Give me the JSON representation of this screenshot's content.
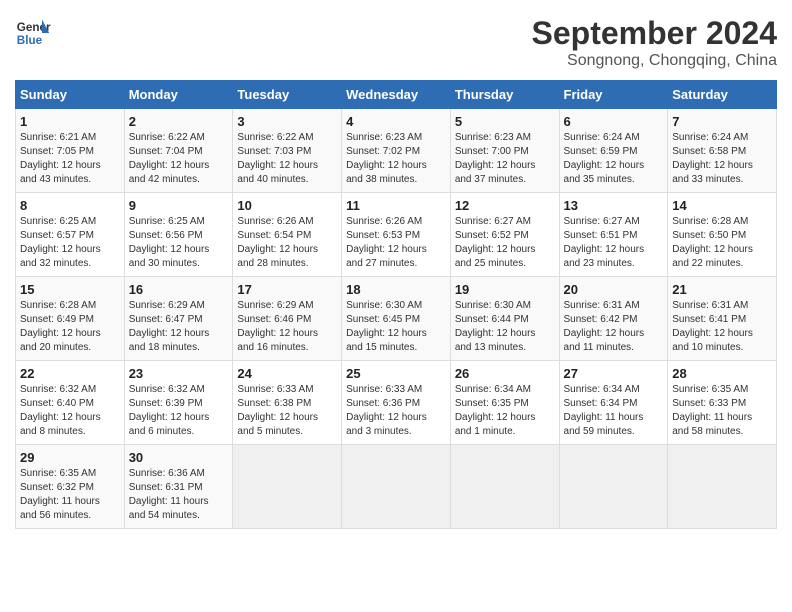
{
  "logo": {
    "line1": "General",
    "line2": "Blue"
  },
  "title": "September 2024",
  "subtitle": "Songnong, Chongqing, China",
  "days_of_week": [
    "Sunday",
    "Monday",
    "Tuesday",
    "Wednesday",
    "Thursday",
    "Friday",
    "Saturday"
  ],
  "weeks": [
    [
      {
        "day": 1,
        "info": "Sunrise: 6:21 AM\nSunset: 7:05 PM\nDaylight: 12 hours\nand 43 minutes."
      },
      {
        "day": 2,
        "info": "Sunrise: 6:22 AM\nSunset: 7:04 PM\nDaylight: 12 hours\nand 42 minutes."
      },
      {
        "day": 3,
        "info": "Sunrise: 6:22 AM\nSunset: 7:03 PM\nDaylight: 12 hours\nand 40 minutes."
      },
      {
        "day": 4,
        "info": "Sunrise: 6:23 AM\nSunset: 7:02 PM\nDaylight: 12 hours\nand 38 minutes."
      },
      {
        "day": 5,
        "info": "Sunrise: 6:23 AM\nSunset: 7:00 PM\nDaylight: 12 hours\nand 37 minutes."
      },
      {
        "day": 6,
        "info": "Sunrise: 6:24 AM\nSunset: 6:59 PM\nDaylight: 12 hours\nand 35 minutes."
      },
      {
        "day": 7,
        "info": "Sunrise: 6:24 AM\nSunset: 6:58 PM\nDaylight: 12 hours\nand 33 minutes."
      }
    ],
    [
      {
        "day": 8,
        "info": "Sunrise: 6:25 AM\nSunset: 6:57 PM\nDaylight: 12 hours\nand 32 minutes."
      },
      {
        "day": 9,
        "info": "Sunrise: 6:25 AM\nSunset: 6:56 PM\nDaylight: 12 hours\nand 30 minutes."
      },
      {
        "day": 10,
        "info": "Sunrise: 6:26 AM\nSunset: 6:54 PM\nDaylight: 12 hours\nand 28 minutes."
      },
      {
        "day": 11,
        "info": "Sunrise: 6:26 AM\nSunset: 6:53 PM\nDaylight: 12 hours\nand 27 minutes."
      },
      {
        "day": 12,
        "info": "Sunrise: 6:27 AM\nSunset: 6:52 PM\nDaylight: 12 hours\nand 25 minutes."
      },
      {
        "day": 13,
        "info": "Sunrise: 6:27 AM\nSunset: 6:51 PM\nDaylight: 12 hours\nand 23 minutes."
      },
      {
        "day": 14,
        "info": "Sunrise: 6:28 AM\nSunset: 6:50 PM\nDaylight: 12 hours\nand 22 minutes."
      }
    ],
    [
      {
        "day": 15,
        "info": "Sunrise: 6:28 AM\nSunset: 6:49 PM\nDaylight: 12 hours\nand 20 minutes."
      },
      {
        "day": 16,
        "info": "Sunrise: 6:29 AM\nSunset: 6:47 PM\nDaylight: 12 hours\nand 18 minutes."
      },
      {
        "day": 17,
        "info": "Sunrise: 6:29 AM\nSunset: 6:46 PM\nDaylight: 12 hours\nand 16 minutes."
      },
      {
        "day": 18,
        "info": "Sunrise: 6:30 AM\nSunset: 6:45 PM\nDaylight: 12 hours\nand 15 minutes."
      },
      {
        "day": 19,
        "info": "Sunrise: 6:30 AM\nSunset: 6:44 PM\nDaylight: 12 hours\nand 13 minutes."
      },
      {
        "day": 20,
        "info": "Sunrise: 6:31 AM\nSunset: 6:42 PM\nDaylight: 12 hours\nand 11 minutes."
      },
      {
        "day": 21,
        "info": "Sunrise: 6:31 AM\nSunset: 6:41 PM\nDaylight: 12 hours\nand 10 minutes."
      }
    ],
    [
      {
        "day": 22,
        "info": "Sunrise: 6:32 AM\nSunset: 6:40 PM\nDaylight: 12 hours\nand 8 minutes."
      },
      {
        "day": 23,
        "info": "Sunrise: 6:32 AM\nSunset: 6:39 PM\nDaylight: 12 hours\nand 6 minutes."
      },
      {
        "day": 24,
        "info": "Sunrise: 6:33 AM\nSunset: 6:38 PM\nDaylight: 12 hours\nand 5 minutes."
      },
      {
        "day": 25,
        "info": "Sunrise: 6:33 AM\nSunset: 6:36 PM\nDaylight: 12 hours\nand 3 minutes."
      },
      {
        "day": 26,
        "info": "Sunrise: 6:34 AM\nSunset: 6:35 PM\nDaylight: 12 hours\nand 1 minute."
      },
      {
        "day": 27,
        "info": "Sunrise: 6:34 AM\nSunset: 6:34 PM\nDaylight: 11 hours\nand 59 minutes."
      },
      {
        "day": 28,
        "info": "Sunrise: 6:35 AM\nSunset: 6:33 PM\nDaylight: 11 hours\nand 58 minutes."
      }
    ],
    [
      {
        "day": 29,
        "info": "Sunrise: 6:35 AM\nSunset: 6:32 PM\nDaylight: 11 hours\nand 56 minutes."
      },
      {
        "day": 30,
        "info": "Sunrise: 6:36 AM\nSunset: 6:31 PM\nDaylight: 11 hours\nand 54 minutes."
      },
      null,
      null,
      null,
      null,
      null
    ]
  ]
}
